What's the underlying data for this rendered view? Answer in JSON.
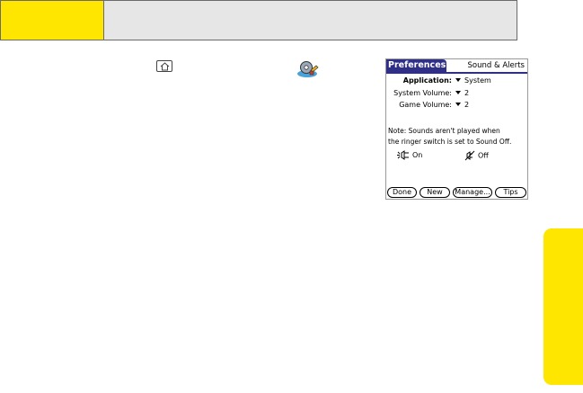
{
  "colors": {
    "accent_yellow": "#ffe600",
    "header_gray": "#e6e6e6",
    "palm_titlebar": "#2f2f88"
  },
  "icons": {
    "home": "home-key-icon",
    "preferences": "preferences-app-icon"
  },
  "palm": {
    "title": "Preferences",
    "category": "Sound & Alerts",
    "settings": [
      {
        "label": "Application:",
        "value": "System"
      },
      {
        "label": "System Volume:",
        "value": "2"
      },
      {
        "label": "Game Volume:",
        "value": "2"
      }
    ],
    "note_line1": "Note: Sounds aren't played when",
    "note_line2": "the ringer switch is set to Sound Off.",
    "toggle_on": "On",
    "toggle_off": "Off",
    "buttons": {
      "done": "Done",
      "new": "New",
      "manage": "Manage...",
      "tips": "Tips"
    }
  }
}
